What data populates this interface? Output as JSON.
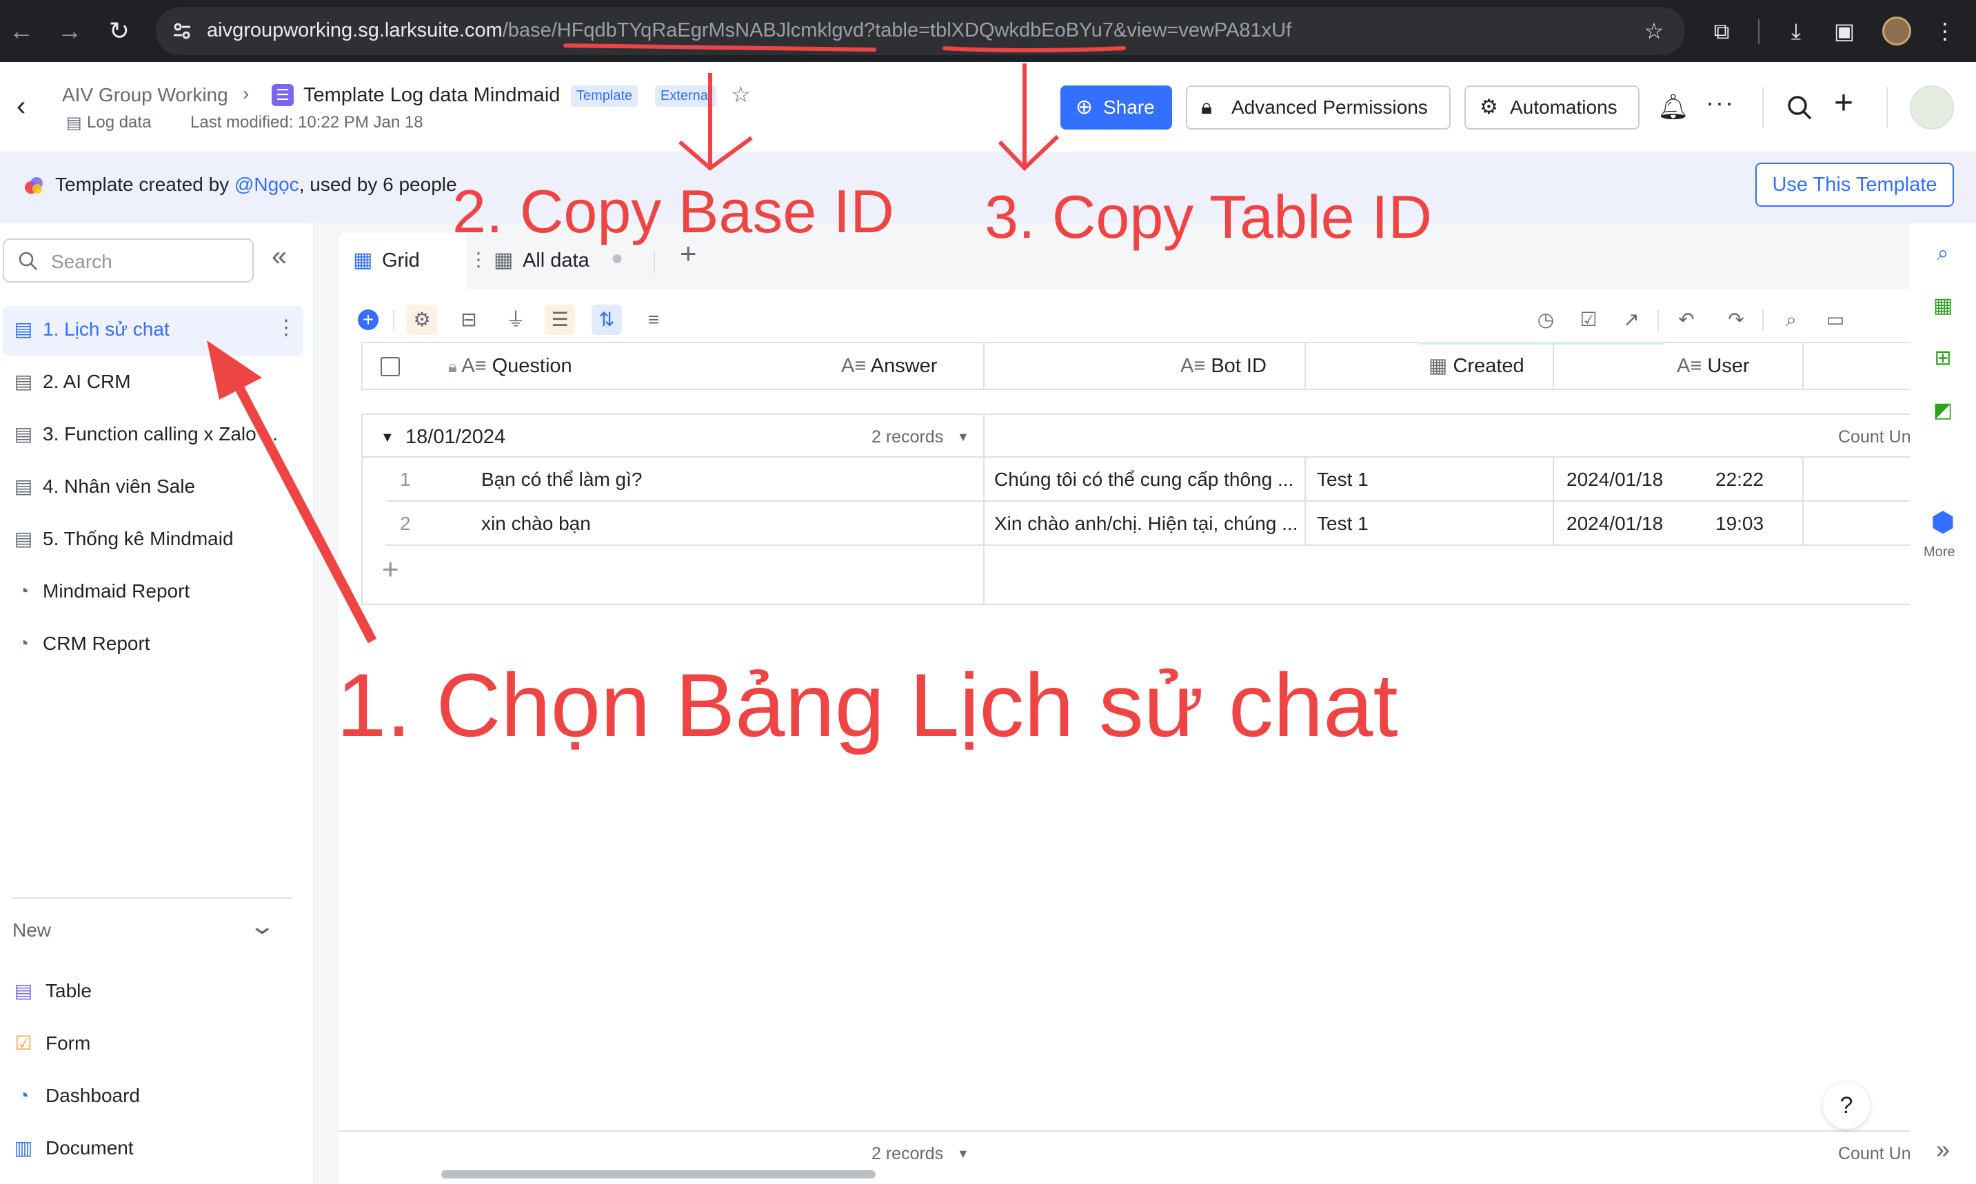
{
  "browser": {
    "url_host": "aivgroupworking.sg.larksuite.com",
    "url_path": "/base/HFqdbTYqRaEgrMsNABJlcmklgvd?table=tblXDQwkdbEoBYu7&view=vewPA81xUf"
  },
  "header": {
    "breadcrumb_workspace": "AIV Group Working",
    "doc_title": "Template Log data Mindmaid",
    "tag_template": "Template",
    "tag_external": "External",
    "subtitle_type": "Log data",
    "last_modified": "Last modified: 10:22 PM Jan 18",
    "share_label": "Share",
    "permissions_label": "Advanced Permissions",
    "automations_label": "Automations"
  },
  "template_bar": {
    "prefix": "Template created by ",
    "author": "@Ngọc",
    "suffix": ", used by 6 people",
    "use_button": "Use This Template"
  },
  "sidebar": {
    "search_placeholder": "Search",
    "items": [
      {
        "label": "1. Lịch sử chat",
        "icon": "table-icon"
      },
      {
        "label": "2. AI CRM",
        "icon": "table-icon"
      },
      {
        "label": "3. Function calling x Zalo ...",
        "icon": "table-icon"
      },
      {
        "label": "4. Nhân viên Sale",
        "icon": "table-icon"
      },
      {
        "label": "5. Thống kê Mindmaid",
        "icon": "table-icon"
      },
      {
        "label": "Mindmaid Report",
        "icon": "dashboard-icon"
      },
      {
        "label": "CRM Report",
        "icon": "dashboard-icon"
      }
    ],
    "new_label": "New",
    "new_items": [
      {
        "label": "Table",
        "icon": "table-icon",
        "color": "#7b67ee"
      },
      {
        "label": "Form",
        "icon": "form-icon",
        "color": "#f2a33b"
      },
      {
        "label": "Dashboard",
        "icon": "dashboard-icon",
        "color": "#3370ff"
      },
      {
        "label": "Document",
        "icon": "document-icon",
        "color": "#3370ff"
      }
    ]
  },
  "views": {
    "tabs": [
      "Grid",
      "All data"
    ]
  },
  "grid": {
    "columns": [
      "Question",
      "Answer",
      "Bot ID",
      "Created",
      "User"
    ],
    "group_label": "18/01/2024",
    "group_count": "2 records",
    "count_unique": "Count Un",
    "rows": [
      {
        "num": "1",
        "question": "Bạn có thể làm gì?",
        "answer": "Chúng tôi có thể cung cấp thông ...",
        "bot_id": "Test 1",
        "date": "2024/01/18",
        "time": "22:22"
      },
      {
        "num": "2",
        "question": "xin chào bạn",
        "answer": "Xin chào anh/chị. Hiện tại, chúng ...",
        "bot_id": "Test 1",
        "date": "2024/01/18",
        "time": "19:03"
      }
    ],
    "footer_count": "2 records",
    "footer_count_unique": "Count Un"
  },
  "right_rail": {
    "more_label": "More"
  },
  "annotations": {
    "step1": "1. Chọn Bảng Lịch sử chat",
    "step2": "2. Copy Base ID",
    "step3": "3. Copy Table ID"
  },
  "colors": {
    "accent": "#3370ff",
    "annotation": "#ef4444",
    "selected_bg": "#eef2fe"
  }
}
